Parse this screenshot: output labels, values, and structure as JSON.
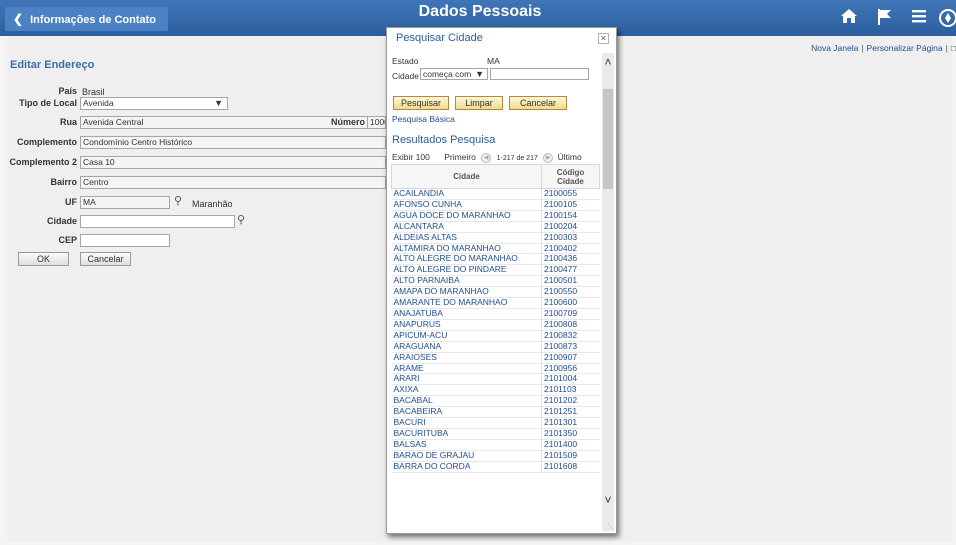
{
  "header": {
    "back_label": "Informações de Contato",
    "title": "Dados Pessoais",
    "icons": [
      "home-icon",
      "flag-icon",
      "menu-icon",
      "compass-icon"
    ]
  },
  "toplinks": {
    "new_window": "Nova Janela",
    "personalize": "Personalizar Página"
  },
  "form": {
    "section_title": "Editar Endereço",
    "pais_label": "País",
    "pais_value": "Brasil",
    "tipo_label": "Tipo de Local",
    "tipo_value": "Avenida",
    "rua_label": "Rua",
    "rua_value": "Avenida Central",
    "numero_label": "Número",
    "numero_value": "1000",
    "complemento_label": "Complemento",
    "complemento_value": "Condomínio Centro Histórico",
    "complemento2_label": "Complemento 2",
    "complemento2_value": "Casa 10",
    "bairro_label": "Bairro",
    "bairro_value": "Centro",
    "uf_label": "UF",
    "uf_value": "MA",
    "uf_desc": "Maranhão",
    "cidade_label": "Cidade",
    "cidade_value": "",
    "cep_label": "CEP",
    "cep_value": "",
    "ok_label": "OK",
    "cancel_label": "Cancelar"
  },
  "modal": {
    "title": "Pesquisar Cidade",
    "estado_label": "Estado",
    "estado_value": "MA",
    "cidade_label": "Cidade",
    "operator_value": "começa com",
    "cidade_search_value": "",
    "btn_search": "Pesquisar",
    "btn_clear": "Limpar",
    "btn_cancel": "Cancelar",
    "basic_search": "Pesquisa Básica",
    "results_title": "Resultados Pesquisa",
    "show": "Exibir 100",
    "first": "Primeiro",
    "range": "1-217 de 217",
    "last": "Último",
    "col_city": "Cidade",
    "col_code_line1": "Código",
    "col_code_line2": "Cidade",
    "rows": [
      {
        "city": "ACAILANDIA",
        "code": "2100055"
      },
      {
        "city": "AFONSO CUNHA",
        "code": "2100105"
      },
      {
        "city": "AGUA DOCE DO MARANHAO",
        "code": "2100154"
      },
      {
        "city": "ALCANTARA",
        "code": "2100204"
      },
      {
        "city": "ALDEIAS ALTAS",
        "code": "2100303"
      },
      {
        "city": "ALTAMIRA DO MARANHAO",
        "code": "2100402"
      },
      {
        "city": "ALTO ALEGRE DO MARANHAO",
        "code": "2100436"
      },
      {
        "city": "ALTO ALEGRE DO PINDARE",
        "code": "2100477"
      },
      {
        "city": "ALTO PARNAIBA",
        "code": "2100501"
      },
      {
        "city": "AMAPA DO MARANHAO",
        "code": "2100550"
      },
      {
        "city": "AMARANTE DO MARANHAO",
        "code": "2100600"
      },
      {
        "city": "ANAJATUBA",
        "code": "2100709"
      },
      {
        "city": "ANAPURUS",
        "code": "2100808"
      },
      {
        "city": "APICUM-ACU",
        "code": "2100832"
      },
      {
        "city": "ARAGUANA",
        "code": "2100873"
      },
      {
        "city": "ARAIOSES",
        "code": "2100907"
      },
      {
        "city": "ARAME",
        "code": "2100956"
      },
      {
        "city": "ARARI",
        "code": "2101004"
      },
      {
        "city": "AXIXA",
        "code": "2101103"
      },
      {
        "city": "BACABAL",
        "code": "2101202"
      },
      {
        "city": "BACABEIRA",
        "code": "2101251"
      },
      {
        "city": "BACURI",
        "code": "2101301"
      },
      {
        "city": "BACURITUBA",
        "code": "2101350"
      },
      {
        "city": "BALSAS",
        "code": "2101400"
      },
      {
        "city": "BARAO DE GRAJAU",
        "code": "2101509"
      },
      {
        "city": "BARRA DO CORDA",
        "code": "2101608"
      }
    ]
  }
}
